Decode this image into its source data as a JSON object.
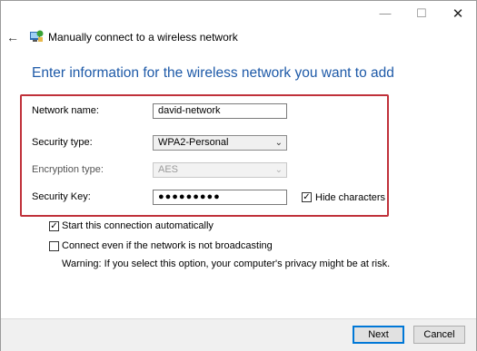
{
  "window": {
    "title": "Manually connect to a wireless network",
    "minimize_icon": "minimize-icon",
    "maximize_icon": "maximize-icon",
    "close_icon": "close-icon"
  },
  "back_icon": "back-arrow-icon",
  "heading": "Enter information for the wireless network you want to add",
  "form": {
    "network_name_label": "Network name:",
    "network_name_value": "david-network",
    "security_type_label": "Security type:",
    "security_type_value": "WPA2-Personal",
    "encryption_type_label": "Encryption type:",
    "encryption_type_value": "AES",
    "security_key_label": "Security Key:",
    "security_key_value": "●●●●●●●●●",
    "hide_characters_label": "Hide characters",
    "hide_characters_checked": true
  },
  "options": {
    "start_auto_label": "Start this connection automatically",
    "start_auto_checked": true,
    "connect_hidden_label": "Connect even if the network is not broadcasting",
    "connect_hidden_checked": false,
    "warning": "Warning: If you select this option, your computer's privacy might be at risk."
  },
  "buttons": {
    "next": "Next",
    "cancel": "Cancel"
  },
  "colors": {
    "heading": "#1e5aa8",
    "highlight_border": "#c0313a",
    "focus_border": "#0078d7"
  }
}
